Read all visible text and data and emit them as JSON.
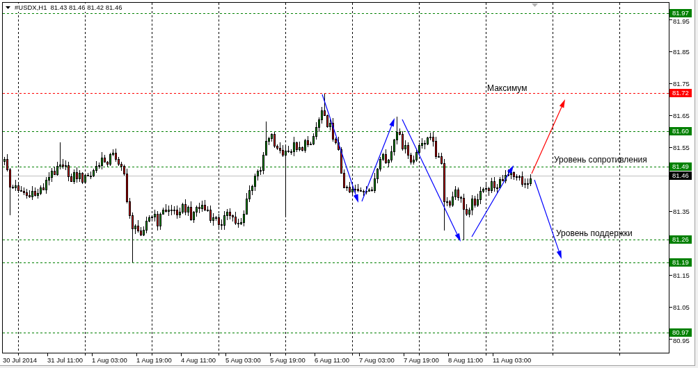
{
  "chart": {
    "header": {
      "symbol": "#USDX,H1",
      "quotes": "81.43 81.46 81.42 81.46"
    },
    "price_axis": {
      "labels": [
        "81.95",
        "81.85",
        "81.75",
        "81.65",
        "81.55",
        "81.35",
        "81.15",
        "81.05",
        "80.95"
      ]
    },
    "time_axis": {
      "labels": [
        "30 Jul 2014",
        "31 Jul 11:00",
        "1 Aug 03:00",
        "1 Aug 19:00",
        "4 Aug 11:00",
        "5 Aug 03:00",
        "5 Aug 19:00",
        "6 Aug 11:00",
        "7 Aug 03:00",
        "7 Aug 19:00",
        "8 Aug 11:00",
        "11 Aug 03:00"
      ]
    },
    "levels": [
      {
        "price": "81.97",
        "kind": "level",
        "color": "#008000"
      },
      {
        "price": "81.72",
        "kind": "level",
        "color": "#ff0000"
      },
      {
        "price": "81.60",
        "kind": "level",
        "color": "#008000"
      },
      {
        "price": "81.49",
        "kind": "level",
        "color": "#008000"
      },
      {
        "price": "81.46",
        "kind": "bid",
        "color": "#000000"
      },
      {
        "price": "81.26",
        "kind": "level",
        "color": "#008000"
      },
      {
        "price": "81.19",
        "kind": "level",
        "color": "#008000"
      },
      {
        "price": "80.97",
        "kind": "level",
        "color": "#008000"
      }
    ],
    "annotations": [
      "Максимум",
      "Уровень сопротивления",
      "Уровень поддержки"
    ]
  }
}
